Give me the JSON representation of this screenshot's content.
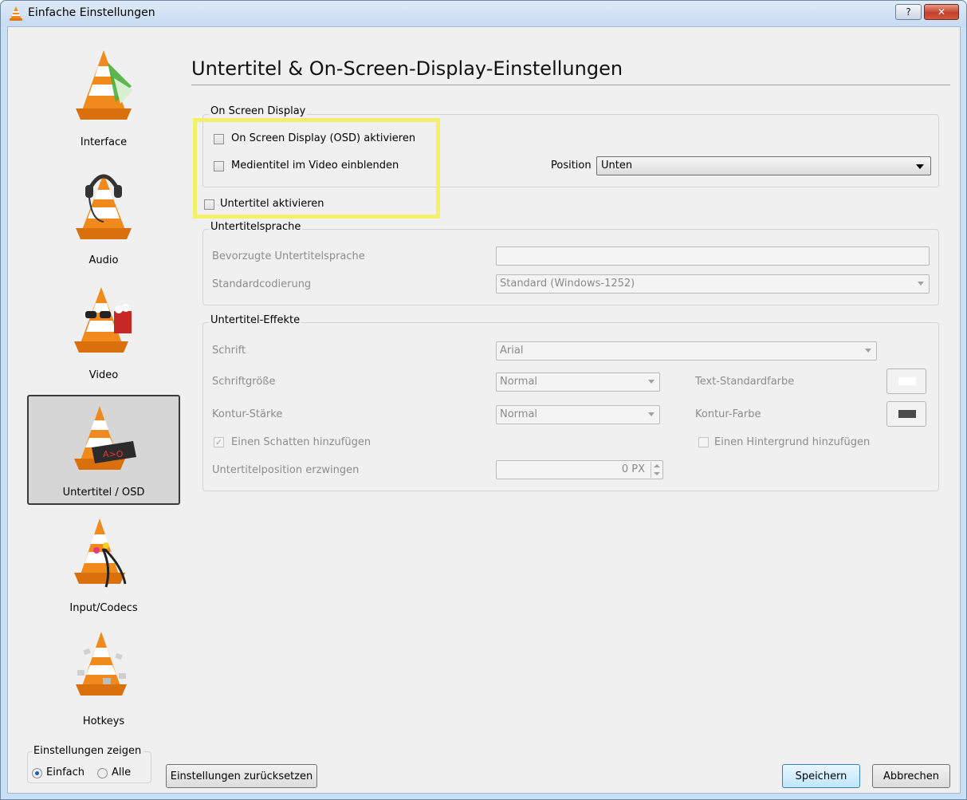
{
  "window": {
    "title": "Einfache Einstellungen",
    "help_btn": "?",
    "close_btn": "✕"
  },
  "sidebar": {
    "items": [
      {
        "label": "Interface"
      },
      {
        "label": "Audio"
      },
      {
        "label": "Video"
      },
      {
        "label": "Untertitel / OSD",
        "selected": true
      },
      {
        "label": "Input/Codecs"
      },
      {
        "label": "Hotkeys"
      }
    ],
    "show_settings": {
      "title": "Einstellungen zeigen",
      "option_simple": "Einfach",
      "option_all": "Alle",
      "selected": "Einfach"
    }
  },
  "main": {
    "title": "Untertitel & On-Screen-Display-Einstellungen",
    "osd_group": {
      "title": "On Screen Display",
      "enable_osd": "On Screen Display (OSD) aktivieren",
      "show_media_title": "Medientitel im Video einblenden",
      "position_label": "Position",
      "position_value": "Unten"
    },
    "enable_subtitles": "Untertitel aktivieren",
    "lang_group": {
      "title": "Untertitelsprache",
      "preferred_label": "Bevorzugte Untertitelsprache",
      "preferred_value": "",
      "encoding_label": "Standardcodierung",
      "encoding_value": "Standard (Windows-1252)"
    },
    "effects_group": {
      "title": "Untertitel-Effekte",
      "font_label": "Schrift",
      "font_value": "Arial",
      "size_label": "Schriftgröße",
      "size_value": "Normal",
      "text_color_label": "Text-Standardfarbe",
      "outline_label": "Kontur-Stärke",
      "outline_value": "Normal",
      "outline_color_label": "Kontur-Farbe",
      "shadow_label": "Einen Schatten hinzufügen",
      "background_label": "Einen Hintergrund hinzufügen",
      "force_pos_label": "Untertitelposition erzwingen",
      "force_pos_value": "0 PX"
    }
  },
  "footer": {
    "reset": "Einstellungen zurücksetzen",
    "save": "Speichern",
    "cancel": "Abbrechen"
  },
  "colors": {
    "text_color": "#ffffff",
    "outline_color": "#4a4a4a",
    "highlight": "#f4f06a",
    "cone_orange": "#f08a1c"
  }
}
